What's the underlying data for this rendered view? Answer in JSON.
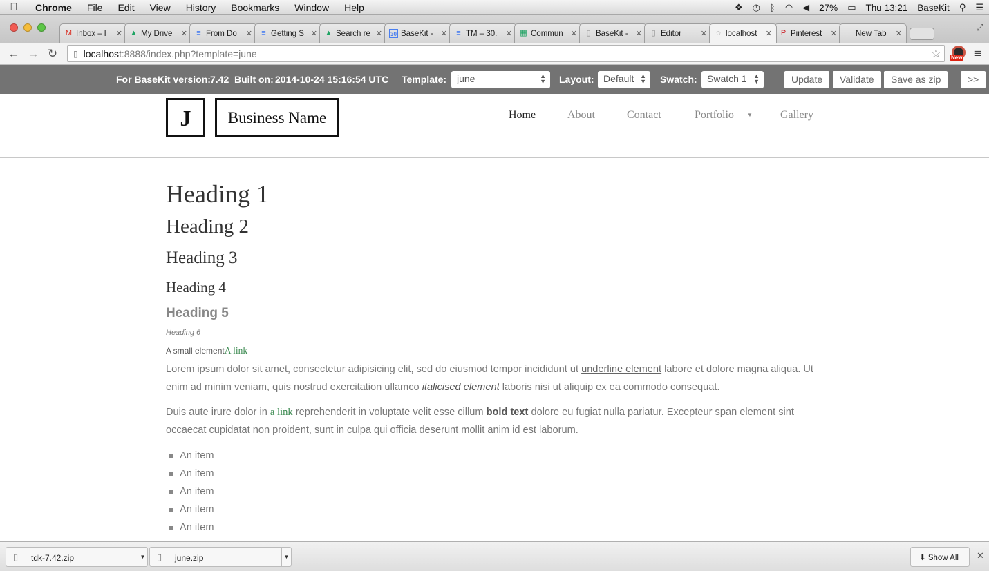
{
  "menubar": {
    "apple": "",
    "items": [
      "Chrome",
      "File",
      "Edit",
      "View",
      "History",
      "Bookmarks",
      "Window",
      "Help"
    ],
    "battery": "27%",
    "clock": "Thu 13:21",
    "user": "BaseKit"
  },
  "tabs": [
    {
      "label": "Inbox – l",
      "icon": "gmail-icon",
      "glyph": "M",
      "color": "#d93025"
    },
    {
      "label": "My Drive",
      "icon": "drive-icon",
      "glyph": "▲",
      "color": "#1fa463"
    },
    {
      "label": "From Do",
      "icon": "docs-icon",
      "glyph": "≡",
      "color": "#4a7ff0"
    },
    {
      "label": "Getting S",
      "icon": "docs-icon",
      "glyph": "≡",
      "color": "#4a7ff0"
    },
    {
      "label": "Search re",
      "icon": "drive-icon",
      "glyph": "▲",
      "color": "#1fa463"
    },
    {
      "label": "BaseKit -",
      "icon": "calendar-icon",
      "glyph": "30",
      "color": "#4a7ff0"
    },
    {
      "label": "TM – 30.",
      "icon": "docs-icon",
      "glyph": "≡",
      "color": "#4a7ff0"
    },
    {
      "label": "Commun",
      "icon": "sheets-icon",
      "glyph": "▦",
      "color": "#0f9d58"
    },
    {
      "label": "BaseKit -",
      "icon": "page-icon",
      "glyph": "▯",
      "color": "#888888"
    },
    {
      "label": "Editor",
      "icon": "page-icon",
      "glyph": "▯",
      "color": "#888888"
    },
    {
      "label": "localhost",
      "icon": "loading-icon",
      "glyph": "◌",
      "color": "#666666",
      "active": true
    },
    {
      "label": "Pinterest",
      "icon": "pinterest-icon",
      "glyph": "P",
      "color": "#cb2027"
    },
    {
      "label": "New Tab",
      "icon": "none",
      "glyph": "",
      "color": "#888888"
    }
  ],
  "address": {
    "host": "localhost",
    "path": ":8888/index.php?template=june"
  },
  "basekit": {
    "version_label": "For BaseKit version:",
    "version": "7.42",
    "built_label": "Built on:",
    "built": "2014-10-24 15:16:54 UTC",
    "template_label": "Template:",
    "template": "june",
    "layout_label": "Layout:",
    "layout": "Default",
    "swatch_label": "Swatch:",
    "swatch": "Swatch 1",
    "update": "Update",
    "validate": "Validate",
    "save_zip": "Save as zip",
    "more": ">>"
  },
  "site": {
    "logo_letter": "J",
    "business_name": "Business Name",
    "nav": [
      "Home",
      "About",
      "Contact",
      "Portfolio",
      "Gallery"
    ]
  },
  "content": {
    "h1": "Heading 1",
    "h2": "Heading 2",
    "h3": "Heading 3",
    "h4": "Heading 4",
    "h5": "Heading 5",
    "h6": "Heading 6",
    "small": "A small element",
    "small_link": "A link",
    "p1_a": "Lorem ipsum dolor sit amet, consectetur adipisicing elit, sed do eiusmod tempor incididunt ut ",
    "p1_u": "underline element",
    "p1_b": " labore et dolore magna aliqua. Ut enim ad minim veniam, quis nostrud exercitation ullamco ",
    "p1_i": "italicised element",
    "p1_c": " laboris nisi ut aliquip ex ea commodo consequat.",
    "p2_a": "Duis aute irure dolor in ",
    "p2_link": "a link",
    "p2_b": " reprehenderit in voluptate velit esse cillum ",
    "p2_bold": "bold text",
    "p2_c": " dolore eu fugiat nulla pariatur. Excepteur span element sint occaecat cupidatat non proident, sunt in culpa qui officia deserunt mollit anim id est laborum.",
    "list": [
      "An item",
      "An item",
      "An item",
      "An item",
      "An item"
    ]
  },
  "downloads": {
    "items": [
      "tdk-7.42.zip",
      "june.zip"
    ],
    "show_all": "Show All"
  }
}
